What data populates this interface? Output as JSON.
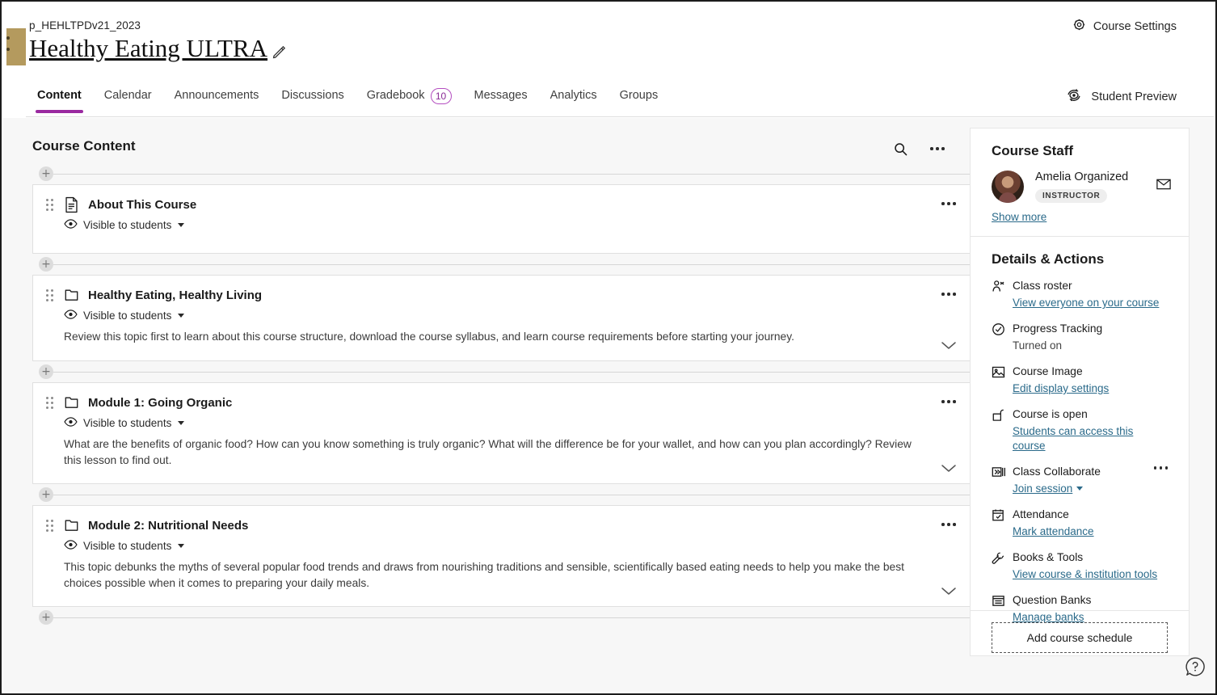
{
  "header": {
    "course_id": "p_HEHLTPDv21_2023",
    "course_title": "Healthy Eating ULTRA",
    "edit_icon": "pencil-icon",
    "course_settings_label": "Course Settings",
    "course_settings_icon": "gear-icon",
    "student_preview_label": "Student Preview",
    "student_preview_icon": "student-preview-icon"
  },
  "tabs": [
    {
      "label": "Content",
      "active": true,
      "badge": null
    },
    {
      "label": "Calendar",
      "active": false,
      "badge": null
    },
    {
      "label": "Announcements",
      "active": false,
      "badge": null
    },
    {
      "label": "Discussions",
      "active": false,
      "badge": null
    },
    {
      "label": "Gradebook",
      "active": false,
      "badge": "10"
    },
    {
      "label": "Messages",
      "active": false,
      "badge": null
    },
    {
      "label": "Analytics",
      "active": false,
      "badge": null
    },
    {
      "label": "Groups",
      "active": false,
      "badge": null
    }
  ],
  "content": {
    "title": "Course Content",
    "search_icon": "search-icon",
    "overflow_icon": "more-options-icon",
    "add_label": "+",
    "items": [
      {
        "title": "About This Course",
        "icon": "document-icon",
        "visibility": "Visible to students",
        "description": null
      },
      {
        "title": "Healthy Eating, Healthy Living",
        "icon": "folder-icon",
        "visibility": "Visible to students",
        "description": "Review this topic first to learn about this course structure, download the course syllabus, and learn course requirements before starting your journey."
      },
      {
        "title": "Module 1: Going Organic",
        "icon": "folder-icon",
        "visibility": "Visible to students",
        "description": "What are the benefits of organic food? How can you know something is truly organic? What will the difference be for your wallet, and how can you plan accordingly? Review this lesson to find out."
      },
      {
        "title": "Module 2: Nutritional Needs",
        "icon": "folder-icon",
        "visibility": "Visible to students",
        "description": "This topic debunks the myths of several popular food trends and draws from nourishing traditions and sensible, scientifically based eating needs to help you make the best choices possible when it comes to preparing your daily meals."
      }
    ]
  },
  "sidebar": {
    "staff_title": "Course Staff",
    "staff": [
      {
        "name": "Amelia Organized",
        "role": "INSTRUCTOR",
        "mail_icon": "envelope-icon"
      }
    ],
    "show_more_label": "Show more",
    "details_title": "Details & Actions",
    "details": [
      {
        "icon": "class-roster-icon",
        "label": "Class roster",
        "link": "View everyone on your course",
        "sub": null,
        "menu": false,
        "caret": false
      },
      {
        "icon": "progress-check-icon",
        "label": "Progress Tracking",
        "link": null,
        "sub": "Turned on",
        "menu": false,
        "caret": false
      },
      {
        "icon": "course-image-icon",
        "label": "Course Image",
        "link": "Edit display settings",
        "sub": null,
        "menu": false,
        "caret": false
      },
      {
        "icon": "open-lock-icon",
        "label": "Course is open",
        "link": "Students can access this course",
        "sub": null,
        "menu": false,
        "caret": false
      },
      {
        "icon": "collaborate-icon",
        "label": "Class Collaborate",
        "link": "Join session",
        "sub": null,
        "menu": true,
        "caret": true
      },
      {
        "icon": "attendance-calendar-icon",
        "label": "Attendance",
        "link": "Mark attendance",
        "sub": null,
        "menu": false,
        "caret": false
      },
      {
        "icon": "books-tools-icon",
        "label": "Books & Tools",
        "link": "View course & institution tools",
        "sub": null,
        "menu": false,
        "caret": false
      },
      {
        "icon": "question-bank-icon",
        "label": "Question Banks",
        "link": "Manage banks",
        "sub": null,
        "menu": false,
        "caret": false
      }
    ],
    "add_schedule_label": "Add course schedule"
  },
  "help": {
    "icon": "help-icon"
  },
  "colors": {
    "accent_purple": "#9a2aa0",
    "badge_border": "#b44ec0",
    "link_blue": "#2a6a8a",
    "page_bg": "#f7f7f7",
    "card_bg": "#ffffff",
    "banner_tan": "#b49a5e"
  }
}
